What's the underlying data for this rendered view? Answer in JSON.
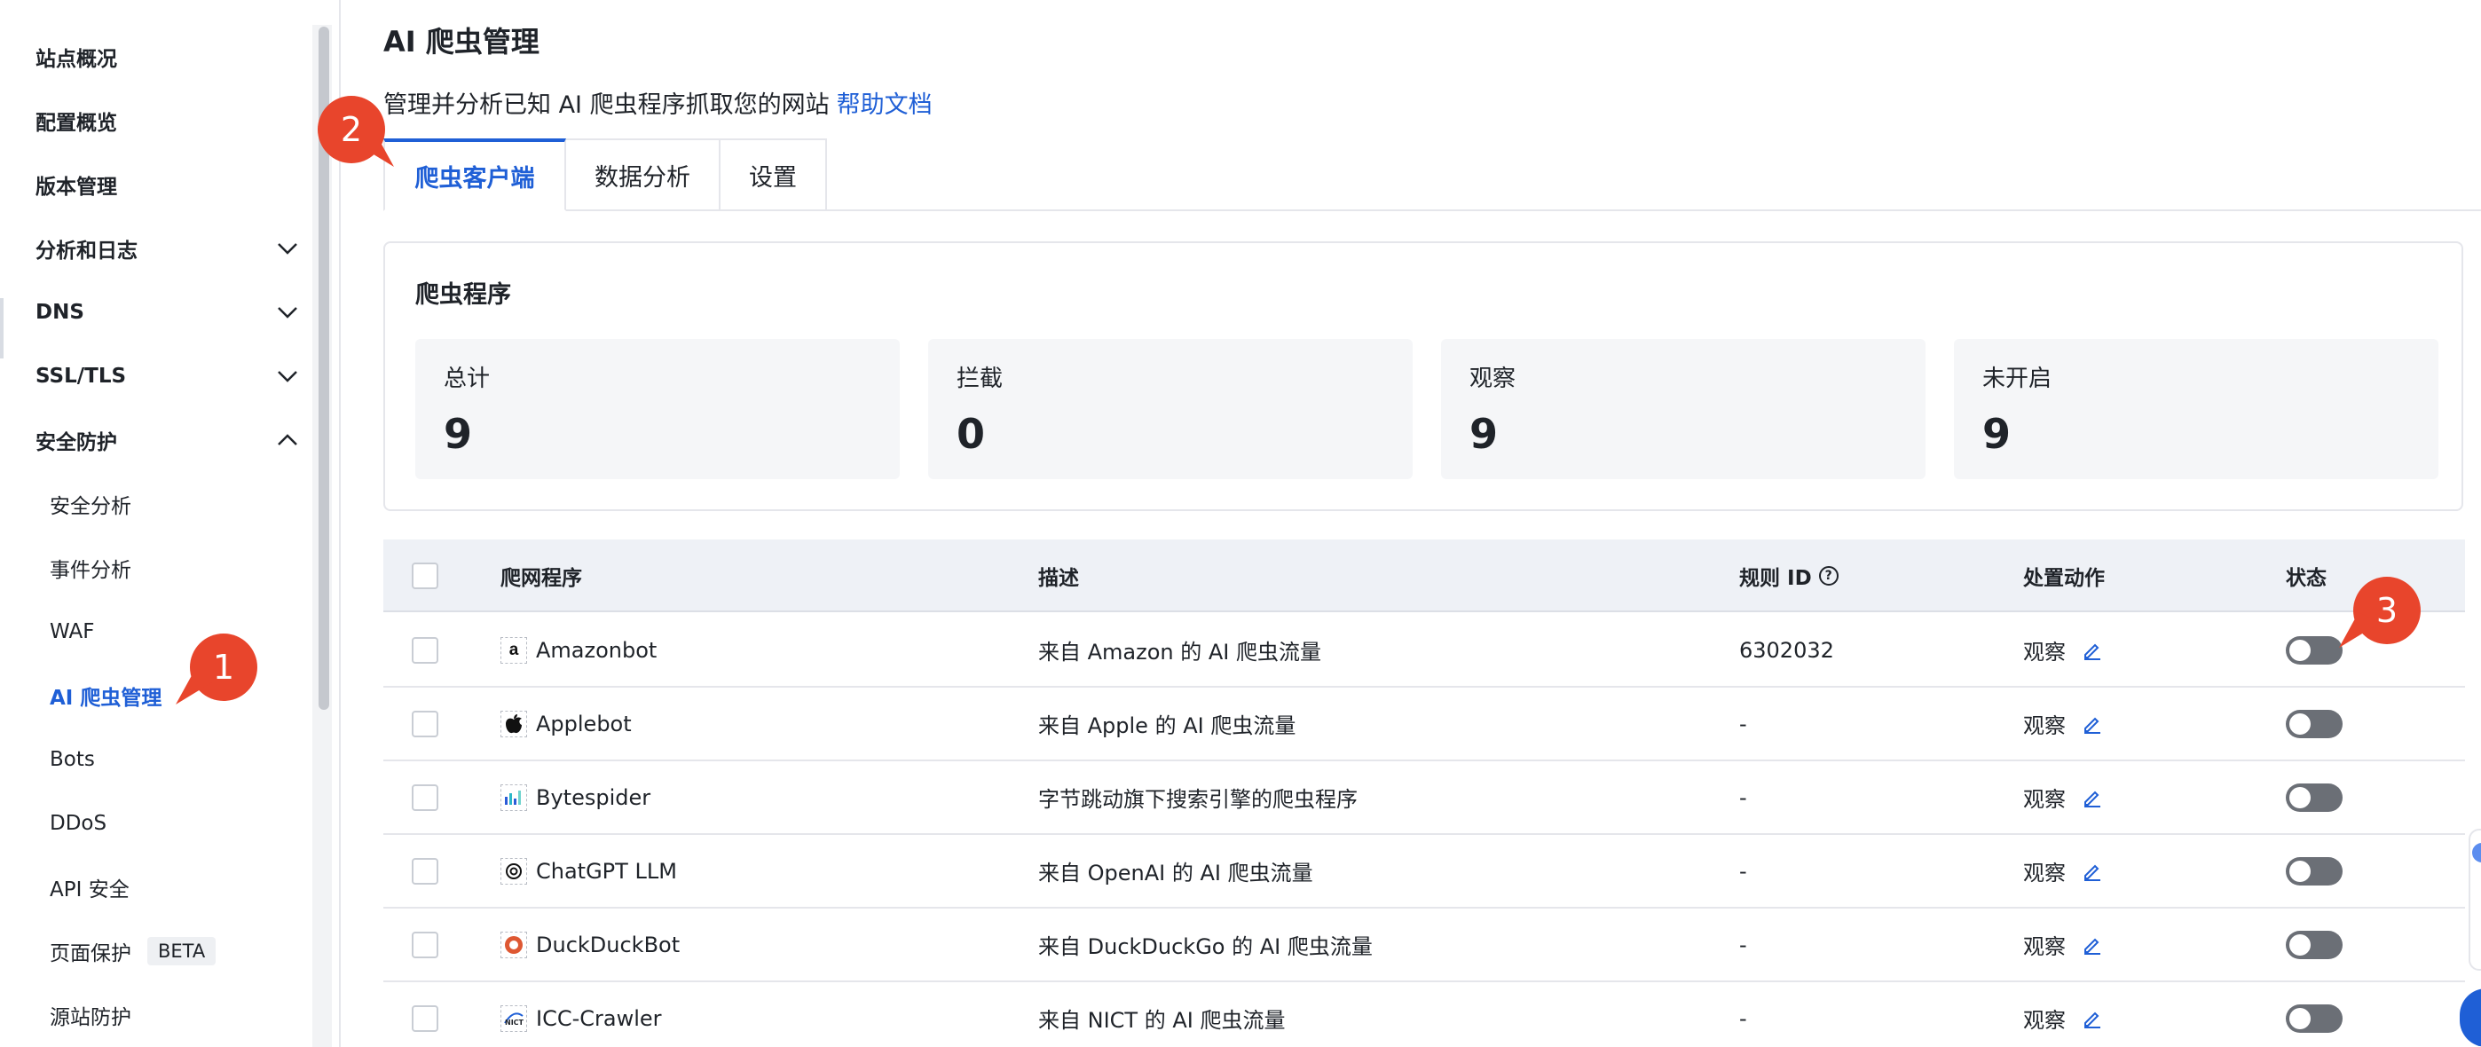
{
  "sidebar": {
    "items": [
      {
        "label": "站点概况"
      },
      {
        "label": "配置概览"
      },
      {
        "label": "版本管理"
      },
      {
        "label": "分析和日志"
      },
      {
        "label": "DNS"
      },
      {
        "label": "SSL/TLS"
      },
      {
        "label": "安全防护"
      }
    ],
    "sub_items": [
      {
        "label": "安全分析"
      },
      {
        "label": "事件分析"
      },
      {
        "label": "WAF"
      },
      {
        "label": "AI 爬虫管理",
        "active": true
      },
      {
        "label": "Bots"
      },
      {
        "label": "DDoS"
      },
      {
        "label": "API 安全"
      },
      {
        "label": "页面保护",
        "badge": "BETA"
      },
      {
        "label": "源站防护"
      }
    ]
  },
  "page": {
    "title": "AI 爬虫管理",
    "description": "管理并分析已知 AI 爬虫程序抓取您的网站",
    "help_link": "帮助文档"
  },
  "tabs": [
    {
      "label": "爬虫客户端",
      "active": true
    },
    {
      "label": "数据分析"
    },
    {
      "label": "设置"
    }
  ],
  "summary": {
    "title": "爬虫程序",
    "stats": [
      {
        "label": "总计",
        "value": "9"
      },
      {
        "label": "拦截",
        "value": "0"
      },
      {
        "label": "观察",
        "value": "9"
      },
      {
        "label": "未开启",
        "value": "9"
      }
    ]
  },
  "table": {
    "headers": {
      "crawler": "爬网程序",
      "description": "描述",
      "rule_id": "规则 ID",
      "action": "处置动作",
      "status": "状态"
    },
    "rows": [
      {
        "name": "Amazonbot",
        "icon": "amazon-icon",
        "icon_glyph": "a",
        "description": "来自 Amazon 的 AI 爬虫流量",
        "rule_id": "6302032",
        "action": "观察"
      },
      {
        "name": "Applebot",
        "icon": "apple-icon",
        "icon_glyph": "",
        "description": "来自 Apple 的 AI 爬虫流量",
        "rule_id": "-",
        "action": "观察"
      },
      {
        "name": "Bytespider",
        "icon": "bytedance-icon",
        "icon_glyph": "",
        "description": "字节跳动旗下搜索引擎的爬虫程序",
        "rule_id": "-",
        "action": "观察"
      },
      {
        "name": "ChatGPT LLM",
        "icon": "openai-icon",
        "icon_glyph": "",
        "description": "来自 OpenAI 的 AI 爬虫流量",
        "rule_id": "-",
        "action": "观察"
      },
      {
        "name": "DuckDuckBot",
        "icon": "duckduckgo-icon",
        "icon_glyph": "",
        "description": "来自 DuckDuckGo 的 AI 爬虫流量",
        "rule_id": "-",
        "action": "观察"
      },
      {
        "name": "ICC-Crawler",
        "icon": "nict-icon",
        "icon_glyph": "",
        "description": "来自 NICT 的 AI 爬虫流量",
        "rule_id": "-",
        "action": "观察"
      }
    ]
  },
  "callouts": [
    "1",
    "2",
    "3"
  ],
  "colors": {
    "accent": "#1f5fd6",
    "callout": "#e8452c",
    "toggle_off": "#6b6f76"
  }
}
